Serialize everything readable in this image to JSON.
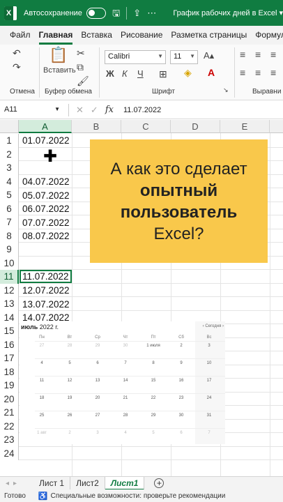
{
  "titlebar": {
    "autosave_label": "Автосохранение",
    "document_title": "График рабочих дней в Excel ▾"
  },
  "menu": {
    "tabs": [
      "Файл",
      "Главная",
      "Вставка",
      "Рисование",
      "Разметка страницы",
      "Формулы"
    ],
    "active_tab": "Главная"
  },
  "ribbon": {
    "undo_label": "Отмена",
    "paste_label": "Вставить",
    "clipboard_label": "Буфер обмена",
    "font_label": "Шрифт",
    "align_label": "Выравни",
    "font_name": "Calibri",
    "font_size": "11",
    "bold": "Ж",
    "italic": "К",
    "underline": "Ч"
  },
  "formula_bar": {
    "name_box": "A11",
    "fx": "fx",
    "value": "11.07.2022"
  },
  "grid": {
    "columns": [
      "A",
      "B",
      "C",
      "D",
      "E"
    ],
    "selected_column": "A",
    "rows": [
      "1",
      "2",
      "3",
      "4",
      "5",
      "6",
      "7",
      "8",
      "9",
      "10",
      "11",
      "12",
      "13",
      "14",
      "15",
      "16",
      "17",
      "18",
      "19",
      "20",
      "21",
      "22",
      "23",
      "24"
    ],
    "selected_row": "11",
    "cells": {
      "A1": "01.07.2022",
      "A4": "04.07.2022",
      "A5": "05.07.2022",
      "A6": "06.07.2022",
      "A7": "07.07.2022",
      "A8": "08.07.2022",
      "A11": "11.07.2022",
      "A12": "12.07.2022",
      "A13": "13.07.2022",
      "A14": "14.07.2022"
    }
  },
  "overlay": {
    "line1": "А как это сделает",
    "line2": "опытный",
    "line3": "пользователь",
    "line4": "Excel?",
    "bg_color": "#f9c84b"
  },
  "calendar": {
    "month_label": "июль",
    "year_label": "2022 г.",
    "today_label": "Сегодня",
    "weekdays": [
      "Пн",
      "Вт",
      "Ср",
      "Чт",
      "Пт",
      "Сб",
      "Вс"
    ],
    "weeks": [
      [
        "27",
        "28",
        "29",
        "30",
        "1 июля",
        "2",
        "3"
      ],
      [
        "4",
        "5",
        "6",
        "7",
        "8",
        "9",
        "10"
      ],
      [
        "11",
        "12",
        "13",
        "14",
        "15",
        "16",
        "17"
      ],
      [
        "18",
        "19",
        "20",
        "21",
        "22",
        "23",
        "24"
      ],
      [
        "25",
        "26",
        "27",
        "28",
        "29",
        "30",
        "31"
      ],
      [
        "1 авг",
        "2",
        "3",
        "4",
        "5",
        "6",
        "7"
      ]
    ]
  },
  "sheets": {
    "tabs": [
      "Лист 1",
      "Лист2",
      "Лист1"
    ],
    "active": "Лист1"
  },
  "status": {
    "ready": "Готово",
    "accessibility": "Специальные возможности: проверьте рекомендации"
  },
  "colors": {
    "accent": "#107c41"
  }
}
